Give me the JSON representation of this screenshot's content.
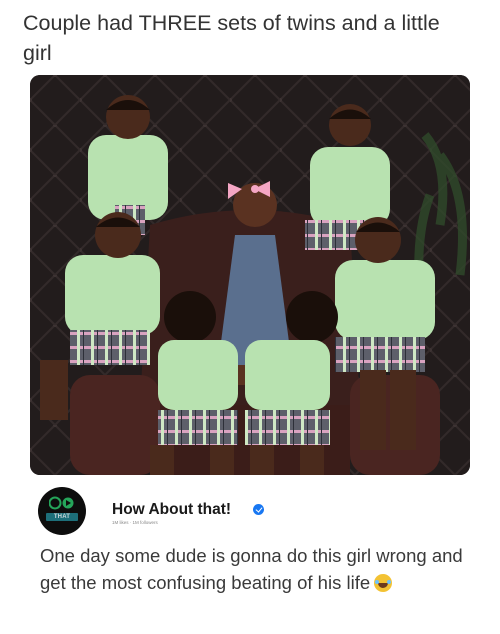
{
  "post": {
    "headline": "Couple had THREE sets of twins and a little girl",
    "image_alt": "Photo of six boys in green shirts and plaid shorts posing around a little girl in a denim dress",
    "page": {
      "name": "How About that!",
      "stats": "1M likes · 1M followers",
      "logo_text": "THAT",
      "verified": true
    },
    "caption": "One day some dude is gonna do this girl wrong and get the most confusing beating of his life",
    "caption_emoji": "laughing-crying-emoji",
    "colors": {
      "verified_badge": "#1877f2",
      "shirt_green": "#b8e2b0",
      "background_dark": "#1b1717",
      "girl_dress": "#5a6f8e",
      "girl_bow": "#f4a6c4"
    }
  }
}
